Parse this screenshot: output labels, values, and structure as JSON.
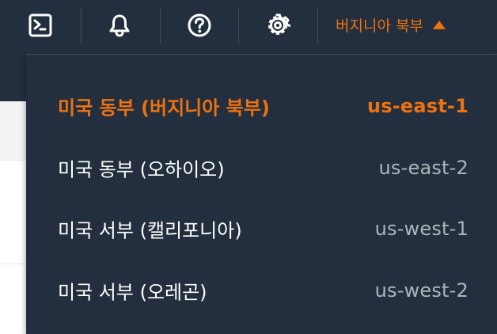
{
  "nav": {
    "icons": {
      "cloudshell": "cloudshell-icon",
      "notifications": "bell-icon",
      "help": "help-icon",
      "settings": "gear-icon"
    },
    "region_selector": {
      "label": "버지니아 북부"
    }
  },
  "region_menu": {
    "items": [
      {
        "name": "미국 동부 (버지니아 북부)",
        "code": "us-east-1",
        "selected": true
      },
      {
        "name": "미국 동부 (오하이오)",
        "code": "us-east-2",
        "selected": false
      },
      {
        "name": "미국 서부 (캘리포니아)",
        "code": "us-west-1",
        "selected": false
      },
      {
        "name": "미국 서부 (오레곤)",
        "code": "us-west-2",
        "selected": false
      }
    ]
  },
  "colors": {
    "nav_bg": "#232f3e",
    "accent": "#ec7211",
    "muted_text": "#aab7b8",
    "text": "#ffffff"
  }
}
